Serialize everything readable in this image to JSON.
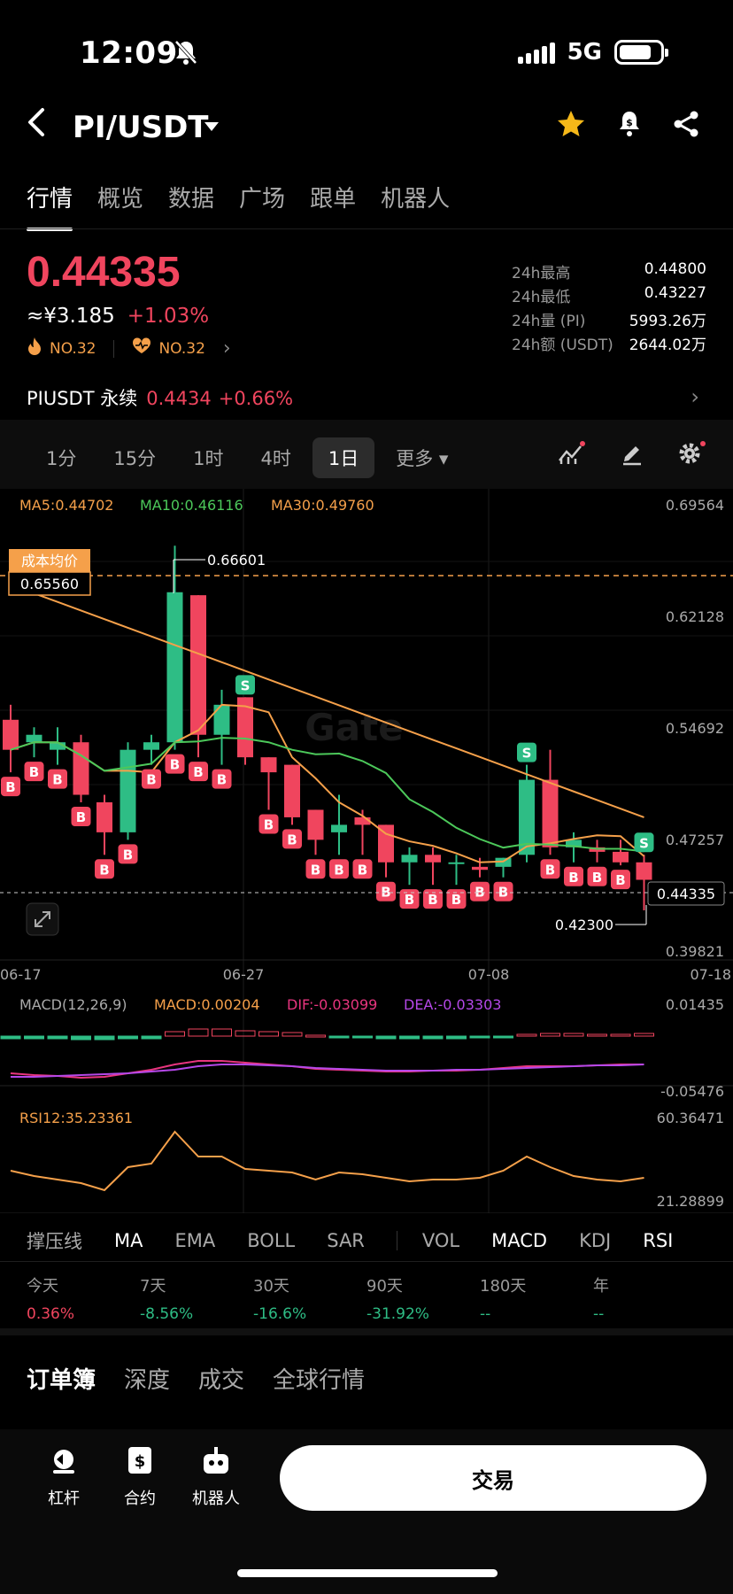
{
  "status": {
    "time": "12:09",
    "network": "5G"
  },
  "header": {
    "pair": "PI/USDT"
  },
  "tabs": [
    "行情",
    "概览",
    "数据",
    "广场",
    "跟单",
    "机器人"
  ],
  "ticker": {
    "price": "0.44335",
    "cny": "≈¥3.185",
    "change": "+1.03%",
    "rank1": "NO.32",
    "rank2": "NO.32",
    "stats": [
      {
        "k": "24h最高",
        "v": "0.44800"
      },
      {
        "k": "24h最低",
        "v": "0.43227"
      },
      {
        "k": "24h量 (PI)",
        "v": "5993.26万"
      },
      {
        "k": "24h额 (USDT)",
        "v": "2644.02万"
      }
    ]
  },
  "perp": {
    "label": "PIUSDT 永续",
    "price": "0.4434",
    "change": "+0.66%"
  },
  "timeframes": [
    "1分",
    "15分",
    "1时",
    "4时",
    "1日",
    "更多"
  ],
  "chart": {
    "ma5": "MA5:0.44702",
    "ma10": "MA10:0.46116",
    "ma30": "MA30:0.49760",
    "y_labels": [
      "0.69564",
      "0.62128",
      "0.54692",
      "0.47257",
      "0.39821"
    ],
    "x_labels": [
      "06-17",
      "06-27",
      "07-08",
      "07-18"
    ],
    "cost_label": "成本均价",
    "cost_value": "0.65560",
    "high_mark": "0.66601",
    "low_mark": "0.42300",
    "last_price": "0.44335",
    "buy_marker": "B",
    "sell_marker": "S",
    "macd": {
      "label": "MACD(12,26,9)",
      "macd": "MACD:0.00204",
      "dif": "DIF:-0.03099",
      "dea": "DEA:-0.03303",
      "top": "0.01435",
      "bottom": "-0.05476"
    },
    "rsi": {
      "label": "RSI12:35.23361",
      "top": "60.36471",
      "bottom": "21.28899"
    },
    "colors": {
      "up": "#2ebd85",
      "down": "#f0455e",
      "ma5": "#f5a04a",
      "ma10": "#4cc85a",
      "ma30": "#f5a04a",
      "dif": "#e8357f",
      "dea": "#b548e8"
    }
  },
  "chart_data": {
    "type": "candlestick",
    "ohlc_approx": [
      [
        0.55,
        0.56,
        0.515,
        0.53
      ],
      [
        0.535,
        0.545,
        0.525,
        0.54
      ],
      [
        0.53,
        0.545,
        0.52,
        0.535
      ],
      [
        0.535,
        0.54,
        0.495,
        0.5
      ],
      [
        0.495,
        0.5,
        0.46,
        0.475
      ],
      [
        0.475,
        0.535,
        0.47,
        0.53
      ],
      [
        0.53,
        0.54,
        0.52,
        0.535
      ],
      [
        0.535,
        0.666,
        0.53,
        0.635
      ],
      [
        0.633,
        0.633,
        0.525,
        0.54
      ],
      [
        0.54,
        0.57,
        0.52,
        0.56
      ],
      [
        0.565,
        0.565,
        0.52,
        0.525
      ],
      [
        0.525,
        0.525,
        0.49,
        0.515
      ],
      [
        0.52,
        0.52,
        0.48,
        0.485
      ],
      [
        0.49,
        0.49,
        0.46,
        0.47
      ],
      [
        0.475,
        0.5,
        0.46,
        0.48
      ],
      [
        0.485,
        0.49,
        0.46,
        0.48
      ],
      [
        0.48,
        0.48,
        0.445,
        0.455
      ],
      [
        0.455,
        0.465,
        0.44,
        0.46
      ],
      [
        0.46,
        0.465,
        0.44,
        0.455
      ],
      [
        0.455,
        0.46,
        0.44,
        0.455
      ],
      [
        0.452,
        0.458,
        0.445,
        0.45
      ],
      [
        0.452,
        0.458,
        0.445,
        0.458
      ],
      [
        0.46,
        0.52,
        0.455,
        0.51
      ],
      [
        0.51,
        0.53,
        0.46,
        0.465
      ],
      [
        0.465,
        0.475,
        0.455,
        0.47
      ],
      [
        0.465,
        0.47,
        0.455,
        0.462
      ],
      [
        0.462,
        0.47,
        0.453,
        0.455
      ],
      [
        0.455,
        0.46,
        0.423,
        0.44335
      ]
    ],
    "ylim": [
      0.39821,
      0.69564
    ]
  },
  "indicators": [
    "撑压线",
    "MA",
    "EMA",
    "BOLL",
    "SAR",
    "VOL",
    "MACD",
    "KDJ",
    "RSI"
  ],
  "performance": [
    {
      "k": "今天",
      "v": "0.36%",
      "c": "red"
    },
    {
      "k": "7天",
      "v": "-8.56%",
      "c": "grn"
    },
    {
      "k": "30天",
      "v": "-16.6%",
      "c": "grn"
    },
    {
      "k": "90天",
      "v": "-31.92%",
      "c": "grn"
    },
    {
      "k": "180天",
      "v": "--",
      "c": "grn"
    },
    {
      "k": "年",
      "v": "--",
      "c": "grn"
    }
  ],
  "book_tabs": [
    "订单簿",
    "深度",
    "成交",
    "全球行情"
  ],
  "bottom_nav": {
    "lever": "杠杆",
    "contract": "合约",
    "robot": "机器人",
    "trade": "交易"
  }
}
